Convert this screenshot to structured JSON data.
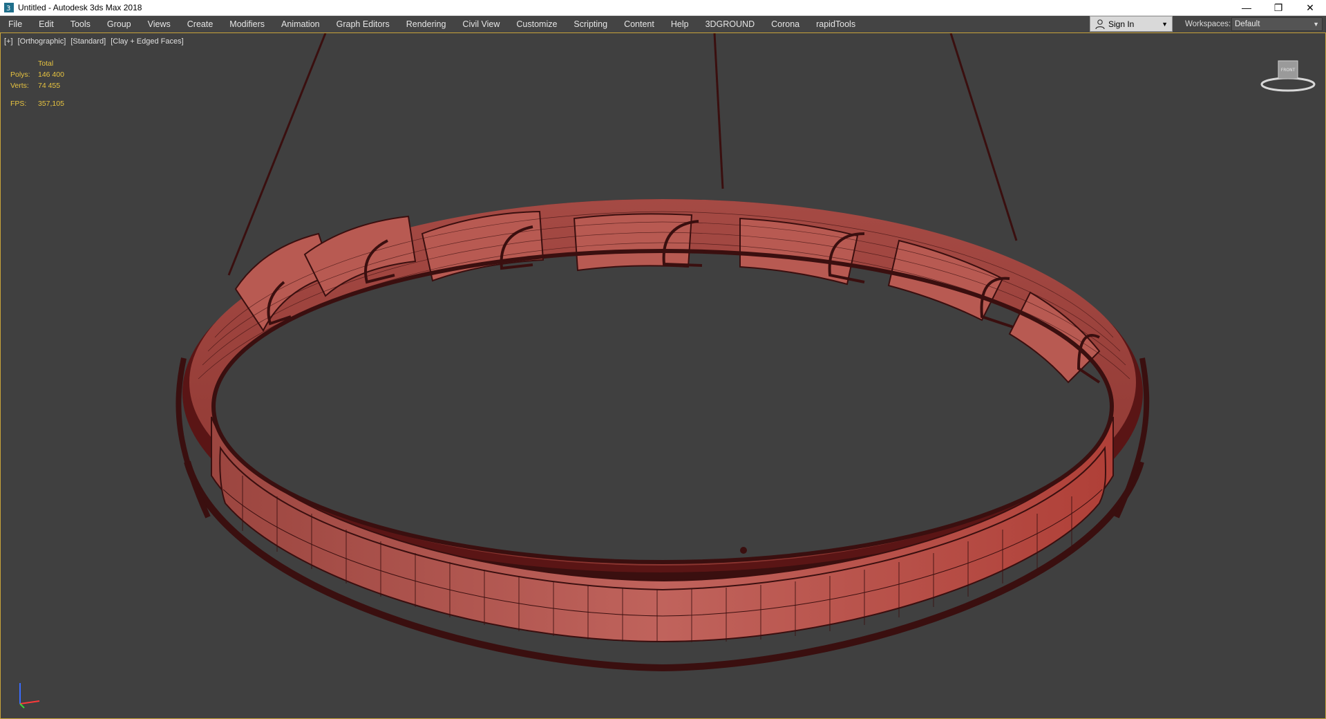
{
  "window": {
    "title": "Untitled - Autodesk 3ds Max 2018",
    "controls": {
      "minimize": "—",
      "restore": "❐",
      "close": "✕"
    }
  },
  "menubar": {
    "items": [
      {
        "label": "File"
      },
      {
        "label": "Edit"
      },
      {
        "label": "Tools"
      },
      {
        "label": "Group"
      },
      {
        "label": "Views"
      },
      {
        "label": "Create"
      },
      {
        "label": "Modifiers"
      },
      {
        "label": "Animation"
      },
      {
        "label": "Graph Editors"
      },
      {
        "label": "Rendering"
      },
      {
        "label": "Civil View"
      },
      {
        "label": "Customize"
      },
      {
        "label": "Scripting"
      },
      {
        "label": "Content"
      },
      {
        "label": "Help"
      },
      {
        "label": "3DGROUND"
      },
      {
        "label": "Corona"
      },
      {
        "label": "rapidTools"
      }
    ],
    "sign_in": "Sign In",
    "workspaces_label": "Workspaces:",
    "workspaces_value": "Default"
  },
  "viewport": {
    "labels": [
      "[+]",
      "[Orthographic]",
      "[Standard]",
      "[Clay + Edged Faces]"
    ],
    "stats": {
      "header": "Total",
      "polys_label": "Polys:",
      "polys": "146 400",
      "verts_label": "Verts:",
      "verts": "74 455",
      "fps_label": "FPS:",
      "fps": "357,105"
    },
    "viewcube_face": "FRONT",
    "colors": {
      "background": "#404040",
      "clay": "#b0504a",
      "wire": "#3a0f0f",
      "stats": "#e8c440",
      "active_border": "#c9a33a"
    }
  }
}
